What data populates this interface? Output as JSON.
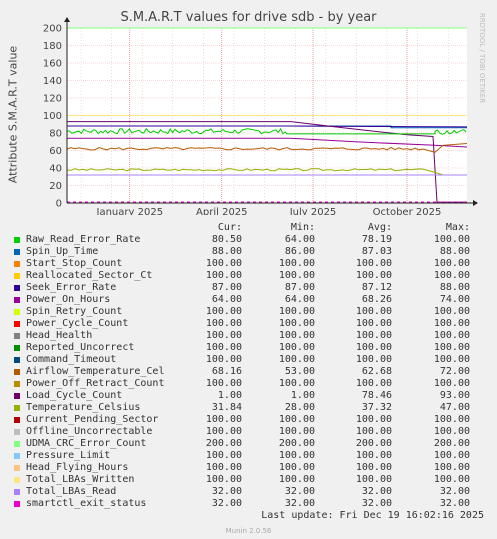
{
  "chart_data": {
    "type": "line",
    "title": "S.M.A.R.T values for drive sdb - by year",
    "ylabel": "Attribute S.M.A.R.T value",
    "ylim": [
      0,
      200
    ],
    "yticks": [
      "0",
      "20",
      "40",
      "60",
      "80",
      "100",
      "120",
      "140",
      "160",
      "180",
      "200"
    ],
    "xticks": [
      "January 2025",
      "April 2025",
      "July 2025",
      "October 2025"
    ],
    "side_text": "RRDTOOL / TOBI OETIKER",
    "columns": [
      "Cur:",
      "Min:",
      "Avg:",
      "Max:"
    ],
    "series": [
      {
        "name": "Raw_Read_Error_Rate",
        "color": "#00cc00",
        "cur": "80.50",
        "min": "64.00",
        "avg": "78.19",
        "max": "100.00"
      },
      {
        "name": "Spin_Up_Time",
        "color": "#0066b3",
        "cur": "88.00",
        "min": "86.00",
        "avg": "87.03",
        "max": "88.00"
      },
      {
        "name": "Start_Stop_Count",
        "color": "#ff8000",
        "cur": "100.00",
        "min": "100.00",
        "avg": "100.00",
        "max": "100.00"
      },
      {
        "name": "Reallocated_Sector_Ct",
        "color": "#ffcc00",
        "cur": "100.00",
        "min": "100.00",
        "avg": "100.00",
        "max": "100.00"
      },
      {
        "name": "Seek_Error_Rate",
        "color": "#330099",
        "cur": "87.00",
        "min": "87.00",
        "avg": "87.12",
        "max": "88.00"
      },
      {
        "name": "Power_On_Hours",
        "color": "#990099",
        "cur": "64.00",
        "min": "64.00",
        "avg": "68.26",
        "max": "74.00"
      },
      {
        "name": "Spin_Retry_Count",
        "color": "#ccff00",
        "cur": "100.00",
        "min": "100.00",
        "avg": "100.00",
        "max": "100.00"
      },
      {
        "name": "Power_Cycle_Count",
        "color": "#ff0000",
        "cur": "100.00",
        "min": "100.00",
        "avg": "100.00",
        "max": "100.00"
      },
      {
        "name": "Head_Health",
        "color": "#808080",
        "cur": "100.00",
        "min": "100.00",
        "avg": "100.00",
        "max": "100.00"
      },
      {
        "name": "Reported_Uncorrect",
        "color": "#008f00",
        "cur": "100.00",
        "min": "100.00",
        "avg": "100.00",
        "max": "100.00"
      },
      {
        "name": "Command_Timeout",
        "color": "#00487d",
        "cur": "100.00",
        "min": "100.00",
        "avg": "100.00",
        "max": "100.00"
      },
      {
        "name": "Airflow_Temperature_Cel",
        "color": "#b35a00",
        "cur": "68.16",
        "min": "53.00",
        "avg": "62.68",
        "max": "72.00"
      },
      {
        "name": "Power_Off_Retract_Count",
        "color": "#b38f00",
        "cur": "100.00",
        "min": "100.00",
        "avg": "100.00",
        "max": "100.00"
      },
      {
        "name": "Load_Cycle_Count",
        "color": "#6b006b",
        "cur": "1.00",
        "min": "1.00",
        "avg": "78.46",
        "max": "93.00"
      },
      {
        "name": "Temperature_Celsius",
        "color": "#8fb300",
        "cur": "31.84",
        "min": "28.00",
        "avg": "37.32",
        "max": "47.00"
      },
      {
        "name": "Current_Pending_Sector",
        "color": "#b30000",
        "cur": "100.00",
        "min": "100.00",
        "avg": "100.00",
        "max": "100.00"
      },
      {
        "name": "Offline_Uncorrectable",
        "color": "#bebebe",
        "cur": "100.00",
        "min": "100.00",
        "avg": "100.00",
        "max": "100.00"
      },
      {
        "name": "UDMA_CRC_Error_Count",
        "color": "#80ff80",
        "cur": "200.00",
        "min": "200.00",
        "avg": "200.00",
        "max": "200.00"
      },
      {
        "name": "Pressure_Limit",
        "color": "#80c9ff",
        "cur": "100.00",
        "min": "100.00",
        "avg": "100.00",
        "max": "100.00"
      },
      {
        "name": "Head_Flying_Hours",
        "color": "#ffc080",
        "cur": "100.00",
        "min": "100.00",
        "avg": "100.00",
        "max": "100.00"
      },
      {
        "name": "Total_LBAs_Written",
        "color": "#ffe680",
        "cur": "100.00",
        "min": "100.00",
        "avg": "100.00",
        "max": "100.00"
      },
      {
        "name": "Total_LBAs_Read",
        "color": "#aa80ff",
        "cur": "32.00",
        "min": "32.00",
        "avg": "32.00",
        "max": "32.00"
      },
      {
        "name": "smartctl_exit_status",
        "color": "#ee00cc",
        "cur": "32.00",
        "min": "32.00",
        "avg": "32.00",
        "max": "32.00"
      }
    ]
  },
  "footer": {
    "last_update": "Last update:  Fri Dec 19 16:02:16 2025",
    "munin": "Munin 2.0.56"
  }
}
